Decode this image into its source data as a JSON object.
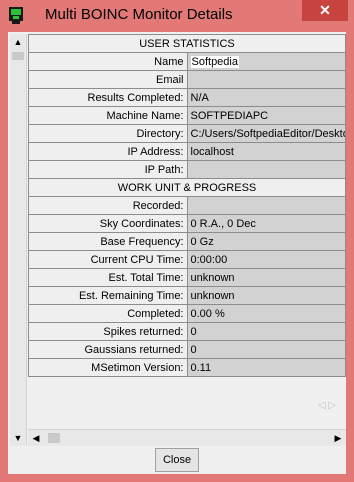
{
  "window": {
    "title": "Multi BOINC Monitor Details",
    "close_glyph": "✕",
    "accent_color": "#e37976"
  },
  "sections": {
    "user_statistics": "USER STATISTICS",
    "work_unit": "WORK UNIT & PROGRESS"
  },
  "user_rows": [
    {
      "label": "Name",
      "value": "Softpedia"
    },
    {
      "label": "Email",
      "value": ""
    },
    {
      "label": "Results Completed:",
      "value": "N/A"
    },
    {
      "label": "Machine Name:",
      "value": "SOFTPEDIAPC"
    },
    {
      "label": "Directory:",
      "value": "C:/Users/SoftpediaEditor/Desktop"
    },
    {
      "label": "IP Address:",
      "value": "localhost"
    },
    {
      "label": "IP Path:",
      "value": ""
    }
  ],
  "work_rows": [
    {
      "label": "Recorded:",
      "value": ""
    },
    {
      "label": "Sky Coordinates:",
      "value": "0 R.A., 0 Dec"
    },
    {
      "label": "Base Frequency:",
      "value": "0 Gz"
    },
    {
      "label": "Current CPU Time:",
      "value": "  0:00:00"
    },
    {
      "label": "Est. Total Time:",
      "value": "unknown"
    },
    {
      "label": "Est. Remaining Time:",
      "value": "unknown"
    },
    {
      "label": "Completed:",
      "value": "0.00 %"
    },
    {
      "label": "Spikes returned:",
      "value": "0"
    },
    {
      "label": "Gaussians returned:",
      "value": "0"
    },
    {
      "label": "MSetimon Version:",
      "value": "0.11"
    }
  ],
  "footer": {
    "close_label": "Close"
  }
}
